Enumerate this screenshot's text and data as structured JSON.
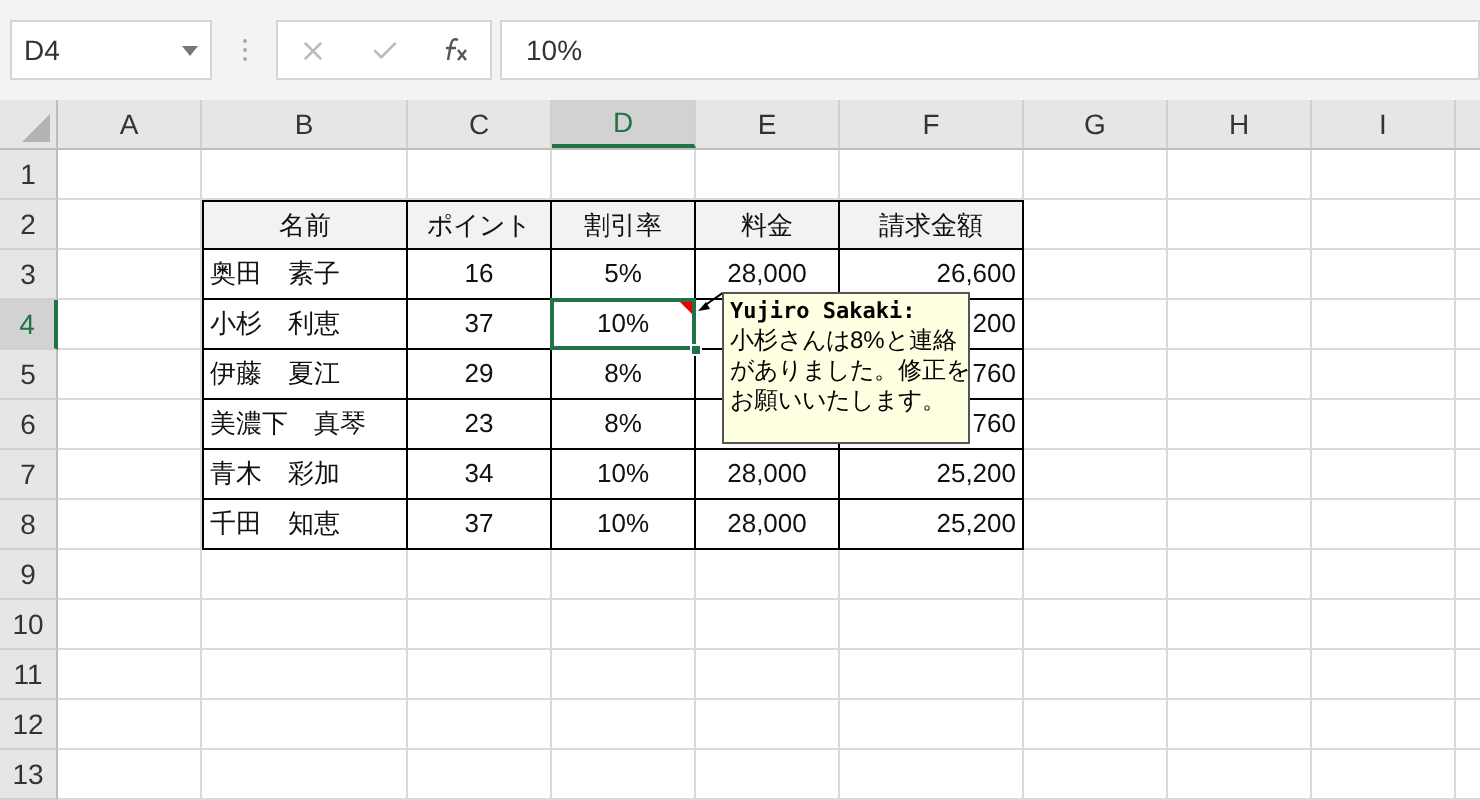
{
  "name_box": {
    "value": "D4"
  },
  "formula_bar": {
    "value": "10%"
  },
  "columns": [
    {
      "label": "A",
      "selected": false
    },
    {
      "label": "B",
      "selected": false
    },
    {
      "label": "C",
      "selected": false
    },
    {
      "label": "D",
      "selected": true
    },
    {
      "label": "E",
      "selected": false
    },
    {
      "label": "F",
      "selected": false
    },
    {
      "label": "G",
      "selected": false
    },
    {
      "label": "H",
      "selected": false
    },
    {
      "label": "I",
      "selected": false
    }
  ],
  "rows": [
    {
      "label": "1",
      "selected": false
    },
    {
      "label": "2",
      "selected": false
    },
    {
      "label": "3",
      "selected": false
    },
    {
      "label": "4",
      "selected": true
    },
    {
      "label": "5",
      "selected": false
    },
    {
      "label": "6",
      "selected": false
    },
    {
      "label": "7",
      "selected": false
    },
    {
      "label": "8",
      "selected": false
    },
    {
      "label": "9",
      "selected": false
    },
    {
      "label": "10",
      "selected": false
    },
    {
      "label": "11",
      "selected": false
    },
    {
      "label": "12",
      "selected": false
    },
    {
      "label": "13",
      "selected": false
    }
  ],
  "table": {
    "header": [
      "名前",
      "ポイント",
      "割引率",
      "料金",
      "請求金額"
    ],
    "rows": [
      [
        {
          "kind": "name",
          "text": "奥田　素子"
        },
        {
          "kind": "num",
          "text": "16"
        },
        {
          "kind": "num",
          "text": "5%"
        },
        {
          "kind": "num",
          "text": "28,000"
        },
        {
          "kind": "amount",
          "text": "26,600"
        }
      ],
      [
        {
          "kind": "name",
          "text": "小杉　利恵"
        },
        {
          "kind": "num",
          "text": "37"
        },
        {
          "kind": "num",
          "text": "10%",
          "active": true,
          "comment": true
        },
        {
          "kind": "num"
        },
        {
          "kind": "amount",
          "text": "200"
        }
      ],
      [
        {
          "kind": "name",
          "text": "伊藤　夏江"
        },
        {
          "kind": "num",
          "text": "29"
        },
        {
          "kind": "num",
          "text": "8%"
        },
        {
          "kind": "num"
        },
        {
          "kind": "amount",
          "text": "760"
        }
      ],
      [
        {
          "kind": "name",
          "text": "美濃下　真琴"
        },
        {
          "kind": "num",
          "text": "23"
        },
        {
          "kind": "num",
          "text": "8%"
        },
        {
          "kind": "num"
        },
        {
          "kind": "amount",
          "text": "760"
        }
      ],
      [
        {
          "kind": "name",
          "text": "青木　彩加"
        },
        {
          "kind": "num",
          "text": "34"
        },
        {
          "kind": "num",
          "text": "10%"
        },
        {
          "kind": "num",
          "text": "28,000"
        },
        {
          "kind": "amount",
          "text": "25,200"
        }
      ],
      [
        {
          "kind": "name",
          "text": "千田　知恵"
        },
        {
          "kind": "num",
          "text": "37"
        },
        {
          "kind": "num",
          "text": "10%"
        },
        {
          "kind": "num",
          "text": "28,000"
        },
        {
          "kind": "amount",
          "text": "25,200"
        }
      ]
    ]
  },
  "comment": {
    "author": "Yujiro Sakaki:",
    "lines": [
      "小杉さんは8%と連絡",
      "がありました。修正を",
      "お願いいたします。"
    ]
  }
}
